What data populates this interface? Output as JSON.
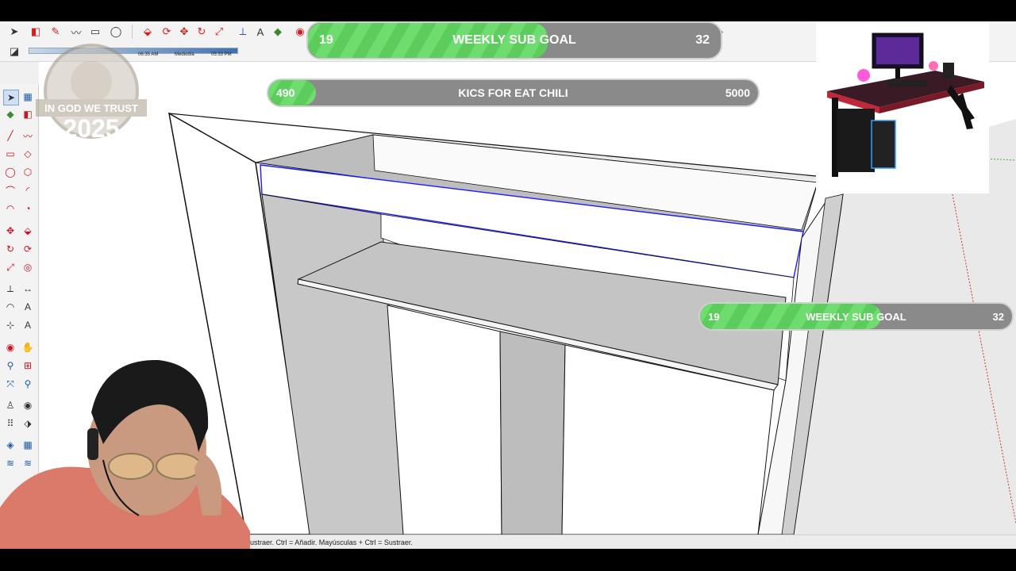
{
  "overlay": {
    "sub_goal_top": {
      "start": "19",
      "title": "WEEKLY SUB GOAL",
      "end": "32",
      "progress": 0.58
    },
    "kicks_goal": {
      "start": "490",
      "title": "KICS FOR EAT CHILI",
      "end": "5000",
      "progress": 0.098
    },
    "sub_goal_right": {
      "start": "19",
      "title": "WEEKLY SUB GOAL",
      "end": "32",
      "progress": 0.58
    },
    "watermark_text": "IN GOD WE TRUST",
    "watermark_year": "2025"
  },
  "toolbar": {
    "shadow_time_left": "06:35 AM",
    "shadow_time_mid": "Mediodía",
    "shadow_time_right": "05:33 PM"
  },
  "status_bar": {
    "hint": "ustraer. Ctrl = Añadir. Mayúsculas + Ctrl = Sustraer."
  },
  "colors": {
    "goal_green": "#6fdc6f",
    "goal_grey": "#8a8a8a",
    "selection_blue": "#1a1aff",
    "axis_red": "#cc3333"
  }
}
